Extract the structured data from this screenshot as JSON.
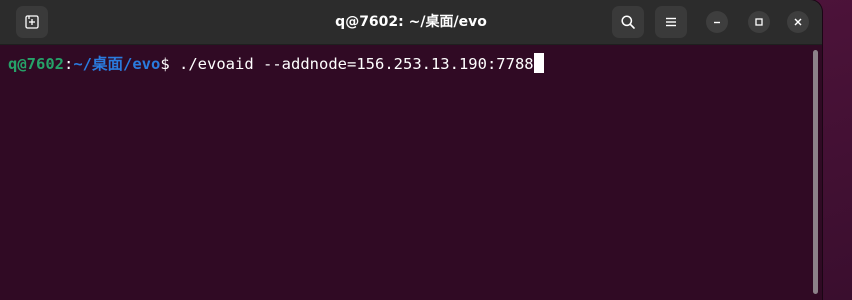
{
  "window": {
    "title": "q@7602: ~/桌面/evo"
  },
  "toolbar": {
    "new_tab_icon": "new-tab-icon",
    "search_icon": "search-icon",
    "menu_icon": "hamburger-menu-icon",
    "minimize_icon": "minimize-icon",
    "maximize_icon": "maximize-icon",
    "close_icon": "close-icon"
  },
  "terminal": {
    "prompt_user_host": "q@7602",
    "prompt_colon": ":",
    "prompt_path": "~/桌面/evo",
    "prompt_symbol": "$",
    "command": " ./evoaid --addnode=156.253.13.190:7788"
  },
  "colors": {
    "terminal_bg": "#300a24",
    "titlebar_bg": "#2c2c2c",
    "prompt_user": "#26a269",
    "prompt_path": "#2a7bde",
    "text": "#ffffff"
  }
}
